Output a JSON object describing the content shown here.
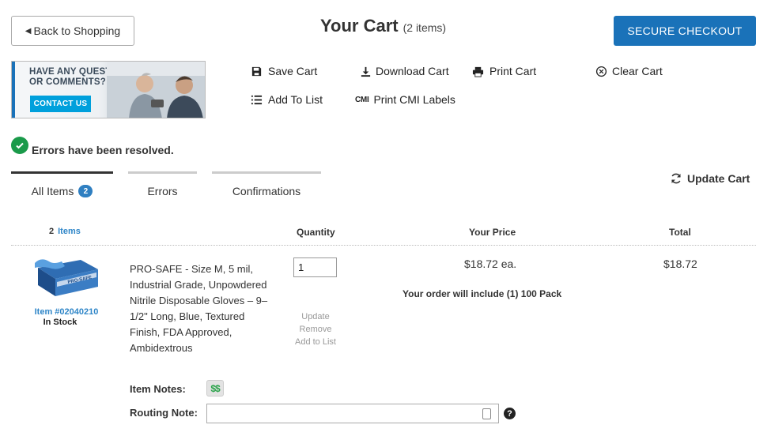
{
  "header": {
    "back_label": "Back to Shopping",
    "title": "Your Cart",
    "item_count": "(2 items)",
    "checkout_label": "SECURE CHECKOUT"
  },
  "banner": {
    "line1": "HAVE ANY QUESTIONS",
    "line2": "OR COMMENTS?",
    "contact_label": "CONTACT US"
  },
  "actions": {
    "save": "Save Cart",
    "download": "Download Cart",
    "print": "Print Cart",
    "clear": "Clear Cart",
    "add_to_list": "Add To List",
    "cmi_icon": "CMI",
    "print_cmi": "Print CMI Labels"
  },
  "status": {
    "message": "Errors have been resolved."
  },
  "tabs": [
    {
      "label": "All Items",
      "badge": "2"
    },
    {
      "label": "Errors"
    },
    {
      "label": "Confirmations"
    }
  ],
  "update_cart": "Update Cart",
  "table": {
    "count": "2",
    "count_label": "Items",
    "quantity": "Quantity",
    "your_price": "Your Price",
    "total": "Total"
  },
  "item": {
    "number": "Item #02040210",
    "stock": "In Stock",
    "description": "PRO-SAFE - Size M, 5 mil, Industrial Grade, Unpowdered Nitrile Disposable Gloves – 9–1/2\" Long, Blue, Textured Finish, FDA Approved, Ambidextrous",
    "quantity": "1",
    "update": "Update",
    "remove": "Remove",
    "add_to_list": "Add to List",
    "price": "$18.72  ea.",
    "pack_note": "Your order will include (1) 100 Pack",
    "total": "$18.72",
    "notes_label": "Item Notes:",
    "notes_icon": "$$",
    "routing_label": "Routing Note:",
    "routing_value": "",
    "box_brand": "PRO-SAFE"
  },
  "colors": {
    "primary": "#1a72b9",
    "link": "#2f86c8",
    "success": "#1a9a4a",
    "banner_button": "#00a0dc"
  },
  "icons": [
    "back-arrow-icon",
    "save-icon",
    "download-icon",
    "print-icon",
    "clear-icon",
    "list-icon",
    "cmi-icon",
    "check-circle-icon",
    "refresh-icon",
    "dollar-notes-icon",
    "contact-card-icon",
    "help-icon"
  ]
}
